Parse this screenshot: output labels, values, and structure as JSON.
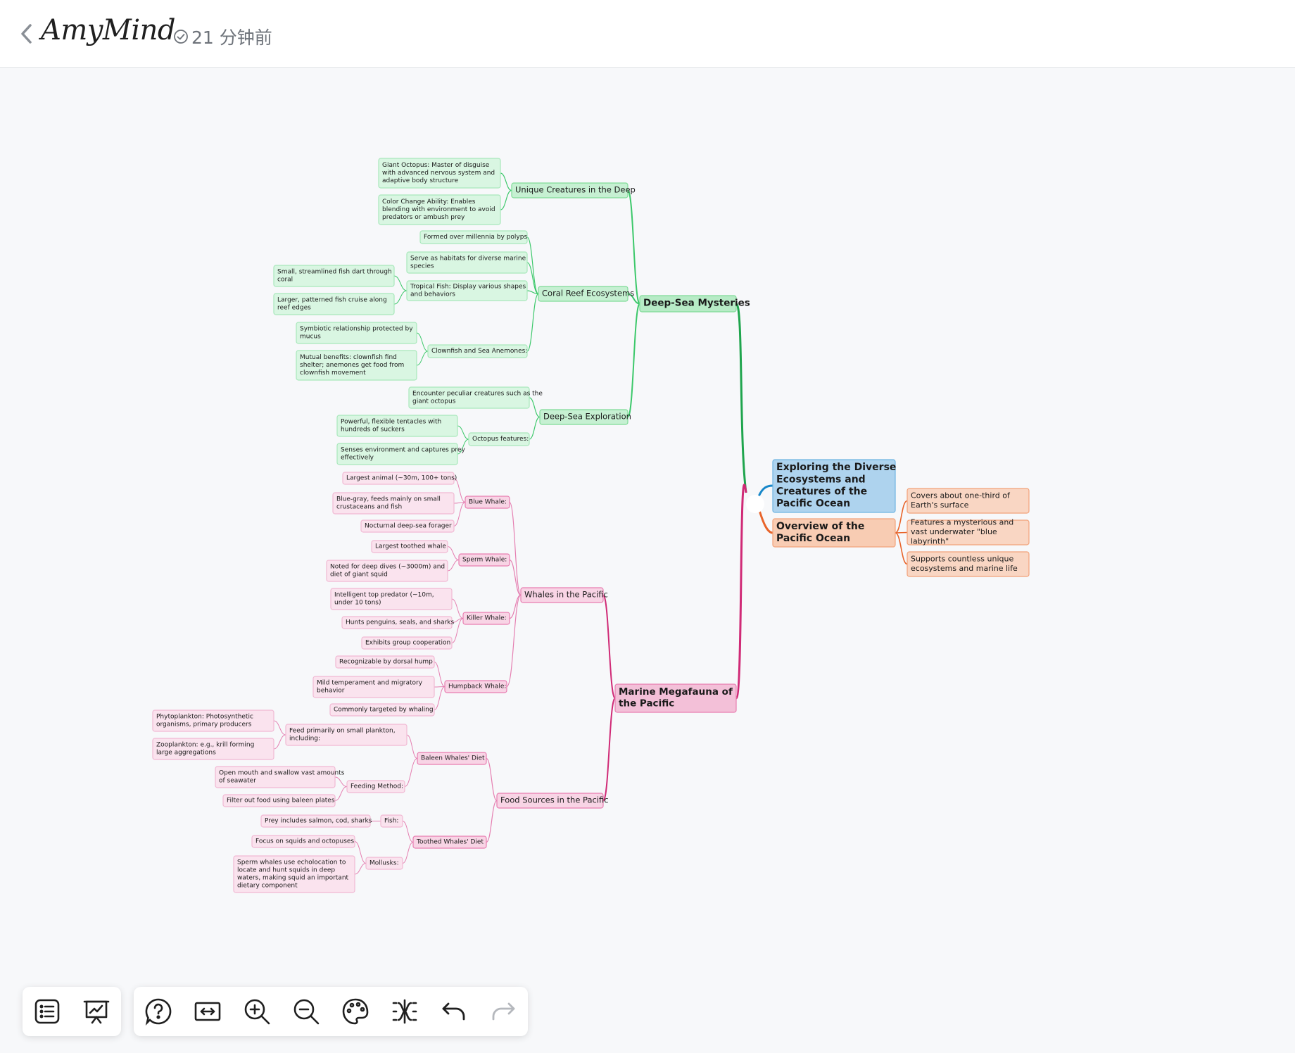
{
  "header": {
    "app_name": "AmyMind",
    "save_status": "21 分钟前"
  },
  "mindmap": {
    "root": "Exploring the Diverse Ecosystems and Creatures of the Pacific Ocean",
    "branches": {
      "overview": {
        "title": "Overview of the Pacific Ocean",
        "items": [
          "Covers about one-third of Earth's surface",
          "Features a mysterious and vast underwater \"blue labyrinth\"",
          "Supports countless unique ecosystems and marine life"
        ]
      },
      "deepsea": {
        "title": "Deep-Sea Mysteries",
        "unique": {
          "title": "Unique Creatures in the Deep",
          "items": [
            "Giant Octopus: Master of disguise with advanced nervous system and adaptive body structure",
            "Color Change Ability: Enables blending with environment to avoid predators or ambush prey"
          ]
        },
        "coral": {
          "title": "Coral Reef Ecosystems",
          "formed": "Formed over millennia by polyps",
          "habitats": "Serve as habitats for diverse marine species",
          "tropical": {
            "title": "Tropical Fish: Display various shapes and behaviors",
            "items": [
              "Small, streamlined fish dart through coral",
              "Larger, patterned fish cruise along reef edges"
            ]
          },
          "clownfish": {
            "title": "Clownfish and Sea Anemones:",
            "items": [
              "Symbiotic relationship protected by mucus",
              "Mutual benefits: clownfish find shelter; anemones get food from clownfish movement"
            ]
          }
        },
        "exploration": {
          "title": "Deep-Sea Exploration",
          "encounter": "Encounter peculiar creatures such as the giant octopus",
          "octopus": {
            "title": "Octopus features:",
            "items": [
              "Powerful, flexible tentacles with hundreds of suckers",
              "Senses environment and captures prey effectively"
            ]
          }
        }
      },
      "megafauna": {
        "title": "Marine Megafauna of the Pacific",
        "whales": {
          "title": "Whales in the Pacific",
          "blue": {
            "title": "Blue Whale:",
            "items": [
              "Largest animal (~30m, 100+ tons)",
              "Blue-gray, feeds mainly on small crustaceans and fish",
              "Nocturnal deep-sea forager"
            ]
          },
          "sperm": {
            "title": "Sperm Whale:",
            "items": [
              "Largest toothed whale",
              "Noted for deep dives (~3000m) and diet of giant squid"
            ]
          },
          "killer": {
            "title": "Killer Whale:",
            "items": [
              "Intelligent top predator (~10m, under 10 tons)",
              "Hunts penguins, seals, and sharks",
              "Exhibits group cooperation"
            ]
          },
          "humpback": {
            "title": "Humpback Whale:",
            "items": [
              "Recognizable by dorsal hump",
              "Mild temperament and migratory behavior",
              "Commonly targeted by whaling"
            ]
          }
        },
        "food": {
          "title": "Food Sources in the Pacific",
          "baleen": {
            "title": "Baleen Whales' Diet",
            "plankton": {
              "title": "Feed primarily on small plankton, including:",
              "items": [
                "Phytoplankton: Photosynthetic organisms, primary producers",
                "Zooplankton: e.g., krill forming large aggregations"
              ]
            },
            "method": {
              "title": "Feeding Method:",
              "items": [
                "Open mouth and swallow vast amounts of seawater",
                "Filter out food using baleen plates"
              ]
            }
          },
          "toothed": {
            "title": "Toothed Whales' Diet",
            "fish": {
              "title": "Fish:",
              "items": [
                "Prey includes salmon, cod, sharks"
              ]
            },
            "mollusks": {
              "title": "Mollusks:",
              "items": [
                "Focus on squids and octopuses",
                "Sperm whales use echolocation to locate and hunt squids in deep waters, making squid an important dietary component"
              ]
            }
          }
        }
      }
    }
  },
  "toolbar": {
    "buttons": [
      "outline-icon",
      "presentation-icon",
      "help-icon",
      "fit-width-icon",
      "zoom-in-icon",
      "zoom-out-icon",
      "theme-palette-icon",
      "layout-structure-icon",
      "undo-icon",
      "redo-icon"
    ]
  },
  "colors": {
    "green_fill": "#b7ebc6",
    "green_border": "#7fdb97",
    "green_line": "#3cc86a",
    "green_dark_line": "#1fa54d",
    "pink_fill": "#f3c0d8",
    "pink_border": "#e87db0",
    "pink_line": "#e57fb1",
    "pink_dark_line": "#d02a76",
    "blue_fill": "#aed3ee",
    "blue_border": "#6fb4e2",
    "orange_fill": "#f8ccb3",
    "orange_border": "#f2a27a",
    "orange_line": "#e8642a"
  }
}
